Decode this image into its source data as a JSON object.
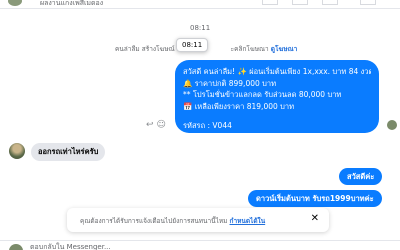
{
  "header": {
    "contact_name": "ผลงานแกงเพสีเมดอง"
  },
  "conversation": {
    "timestamp": "08:11",
    "tooltip_time": "08:11",
    "notice_prefix": "คนล่าลืม สร้างโฆษณ์",
    "notice_suffix": "ะคลิกโฆษณา",
    "notice_link": "ดูโฆษณา",
    "outgoing_big": {
      "line1": "สวัสดี คนล่าลืม! ✨ ผ่อนเริ่มต้นเพียง 1x,xxx. บาท 84 งวด",
      "line2": "🔔 ราคาปกติ 899,000 บาท",
      "line3": "** โปรโมชั่นข้าวแลกลด รับส่วนลด 80,000 บาท",
      "line4": "📅 เหลือเพียงราคา 819,000 บาท",
      "line5": "รหัสรถ : V044"
    },
    "incoming_message": "ออกรถเท่าไหร่ครับ",
    "outgoing_small1": "สวัสดีค่ะ",
    "outgoing_small2": "ดาวน์เริ่มต้นบาท รับรถ1999บาทค่ะ"
  },
  "banner": {
    "text": "คุณต้องการได้รับการแจ้งเตือนไปยังการสนทนานี้ไหม",
    "link": "กำหนดได้ใน",
    "close_icon": "close-icon"
  },
  "composer": {
    "placeholder": "ตอบกลับใน Messenger..."
  },
  "colors": {
    "outgoing": "#0a7cff",
    "incoming": "#e4e6eb",
    "link": "#216fdb"
  }
}
